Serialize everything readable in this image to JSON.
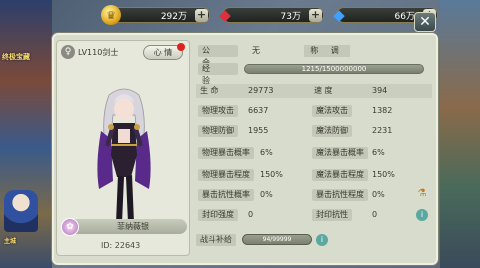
{
  "background": {
    "left_label_top": "终极宝藏",
    "left_label_bottom": "主城"
  },
  "resources": [
    {
      "icon": "gold-coin-icon",
      "value": "292万"
    },
    {
      "icon": "ruby-icon",
      "value": "73万"
    },
    {
      "icon": "diamond-icon",
      "value": "66万"
    }
  ],
  "add_label": "+",
  "close_label": "✕",
  "hero": {
    "level": "LV110剑士",
    "heart_button": "心 情",
    "name": "菲纳薇银",
    "id": "ID:  22643"
  },
  "profile": {
    "guild_label": "公 会",
    "guild_value": "无",
    "title_label": "称 调",
    "exp_label": "经 验",
    "exp_value": "1215/1500000000"
  },
  "stats": [
    {
      "left_label": "生 命",
      "left_value": "29773",
      "right_label": "速 度",
      "right_value": "394"
    },
    {
      "left_label": "物理攻击",
      "left_value": "6637",
      "right_label": "魔法攻击",
      "right_value": "1382"
    },
    {
      "left_label": "物理防御",
      "left_value": "1955",
      "right_label": "魔法防御",
      "right_value": "2231"
    },
    {
      "left_label": "物理暴击概率",
      "left_value": "6%",
      "right_label": "魔法暴击概率",
      "right_value": "6%"
    },
    {
      "left_label": "物理暴击程度",
      "left_value": "150%",
      "right_label": "魔法暴击程度",
      "right_value": "150%"
    },
    {
      "left_label": "暴击抗性概率",
      "left_value": "0%",
      "right_label": "暴击抗性程度",
      "right_value": "0%"
    },
    {
      "left_label": "封印强度",
      "left_value": "0",
      "right_label": "封印抗性",
      "right_value": "0"
    }
  ],
  "supply": {
    "label": "战斗补给",
    "value": "94/99999"
  }
}
